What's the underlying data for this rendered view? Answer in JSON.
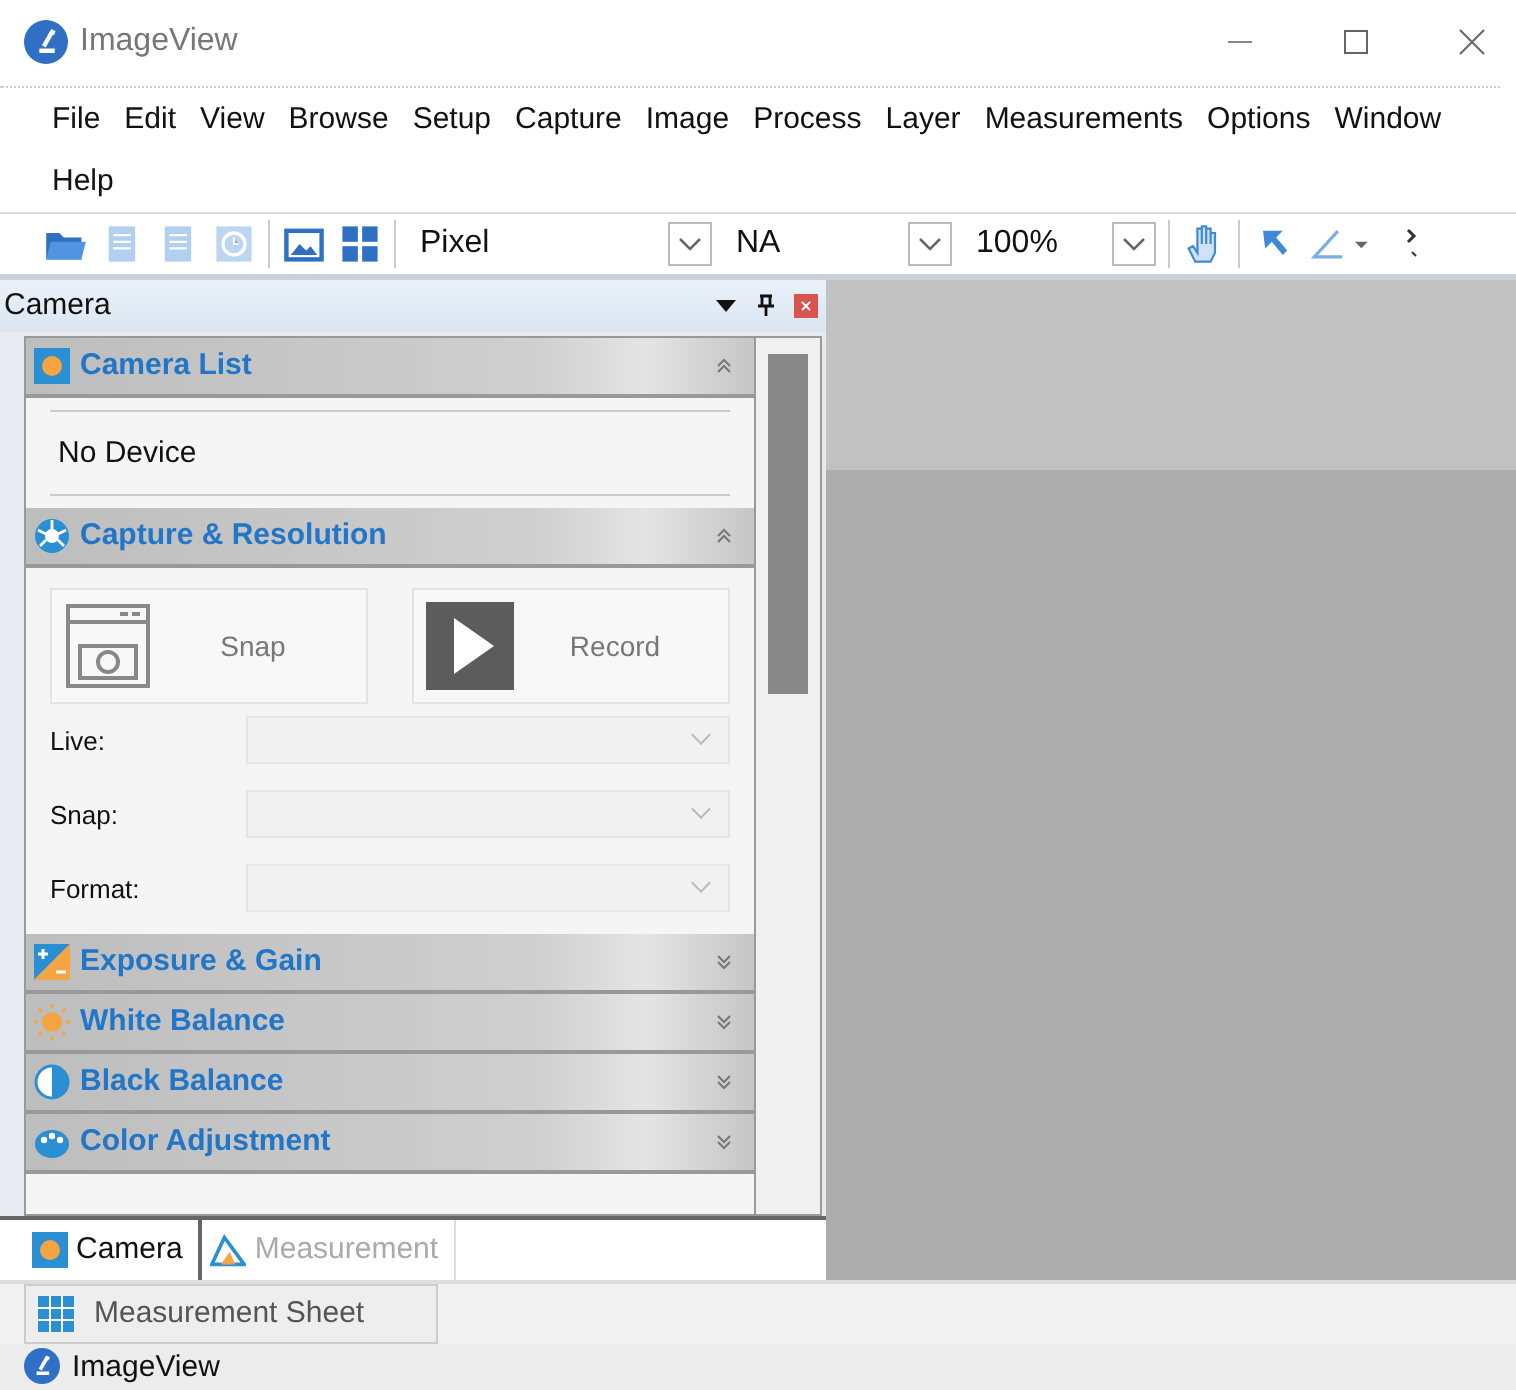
{
  "window": {
    "title": "ImageView"
  },
  "menu": [
    "File",
    "Edit",
    "View",
    "Browse",
    "Setup",
    "Capture",
    "Image",
    "Process",
    "Layer",
    "Measurements",
    "Options",
    "Window",
    "Help"
  ],
  "toolbar": {
    "tools": [
      {
        "kind": "open",
        "disabled": false
      },
      {
        "kind": "document",
        "disabled": true
      },
      {
        "kind": "document",
        "disabled": true
      },
      {
        "kind": "clock",
        "disabled": true
      },
      {
        "kind": "gallery",
        "disabled": false
      },
      {
        "kind": "grid",
        "disabled": false
      }
    ],
    "combos": [
      {
        "value": "Pixel"
      },
      {
        "value": "NA"
      },
      {
        "value": "100%"
      }
    ],
    "tools2": [
      {
        "kind": "hand"
      },
      {
        "kind": "pointer"
      },
      {
        "kind": "angle"
      }
    ]
  },
  "panel": {
    "title": "Camera",
    "sections": [
      {
        "kind": "list",
        "title": "Camera List",
        "expanded": true,
        "items": [
          "No Device"
        ]
      },
      {
        "kind": "capture",
        "title": "Capture & Resolution",
        "expanded": true,
        "buttons": [
          {
            "kind": "snap",
            "label": "Snap"
          },
          {
            "kind": "record",
            "label": "Record"
          }
        ],
        "fields": [
          {
            "label": "Live:",
            "disabled": true
          },
          {
            "label": "Snap:",
            "disabled": true
          },
          {
            "label": "Format:",
            "disabled": true
          }
        ]
      },
      {
        "title": "Exposure & Gain",
        "expanded": false
      },
      {
        "title": "White Balance",
        "expanded": false
      },
      {
        "title": "Black Balance",
        "expanded": false
      },
      {
        "title": "Color Adjustment",
        "expanded": false
      }
    ]
  },
  "dock_tabs": [
    {
      "label": "Camera",
      "selected": true
    },
    {
      "label": "Measurement",
      "selected": false
    }
  ],
  "sheet_tab": {
    "label": "Measurement Sheet"
  },
  "status_bar": {
    "text": "ImageView"
  }
}
